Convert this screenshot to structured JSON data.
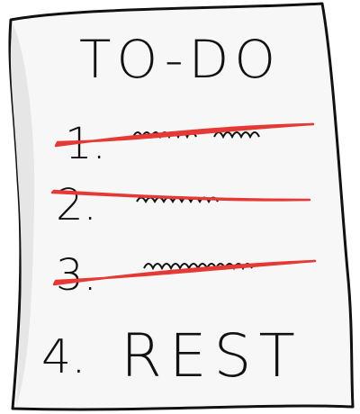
{
  "note": {
    "title": "TO-DO",
    "items": [
      {
        "number": "1.",
        "text": "",
        "done": true
      },
      {
        "number": "2.",
        "text": "",
        "done": true
      },
      {
        "number": "3.",
        "text": "",
        "done": true
      },
      {
        "number": "4.",
        "text": "REST",
        "done": false
      }
    ]
  },
  "colors": {
    "paper": "#f7f7f7",
    "ink": "#111111",
    "strike": "#e53935"
  }
}
